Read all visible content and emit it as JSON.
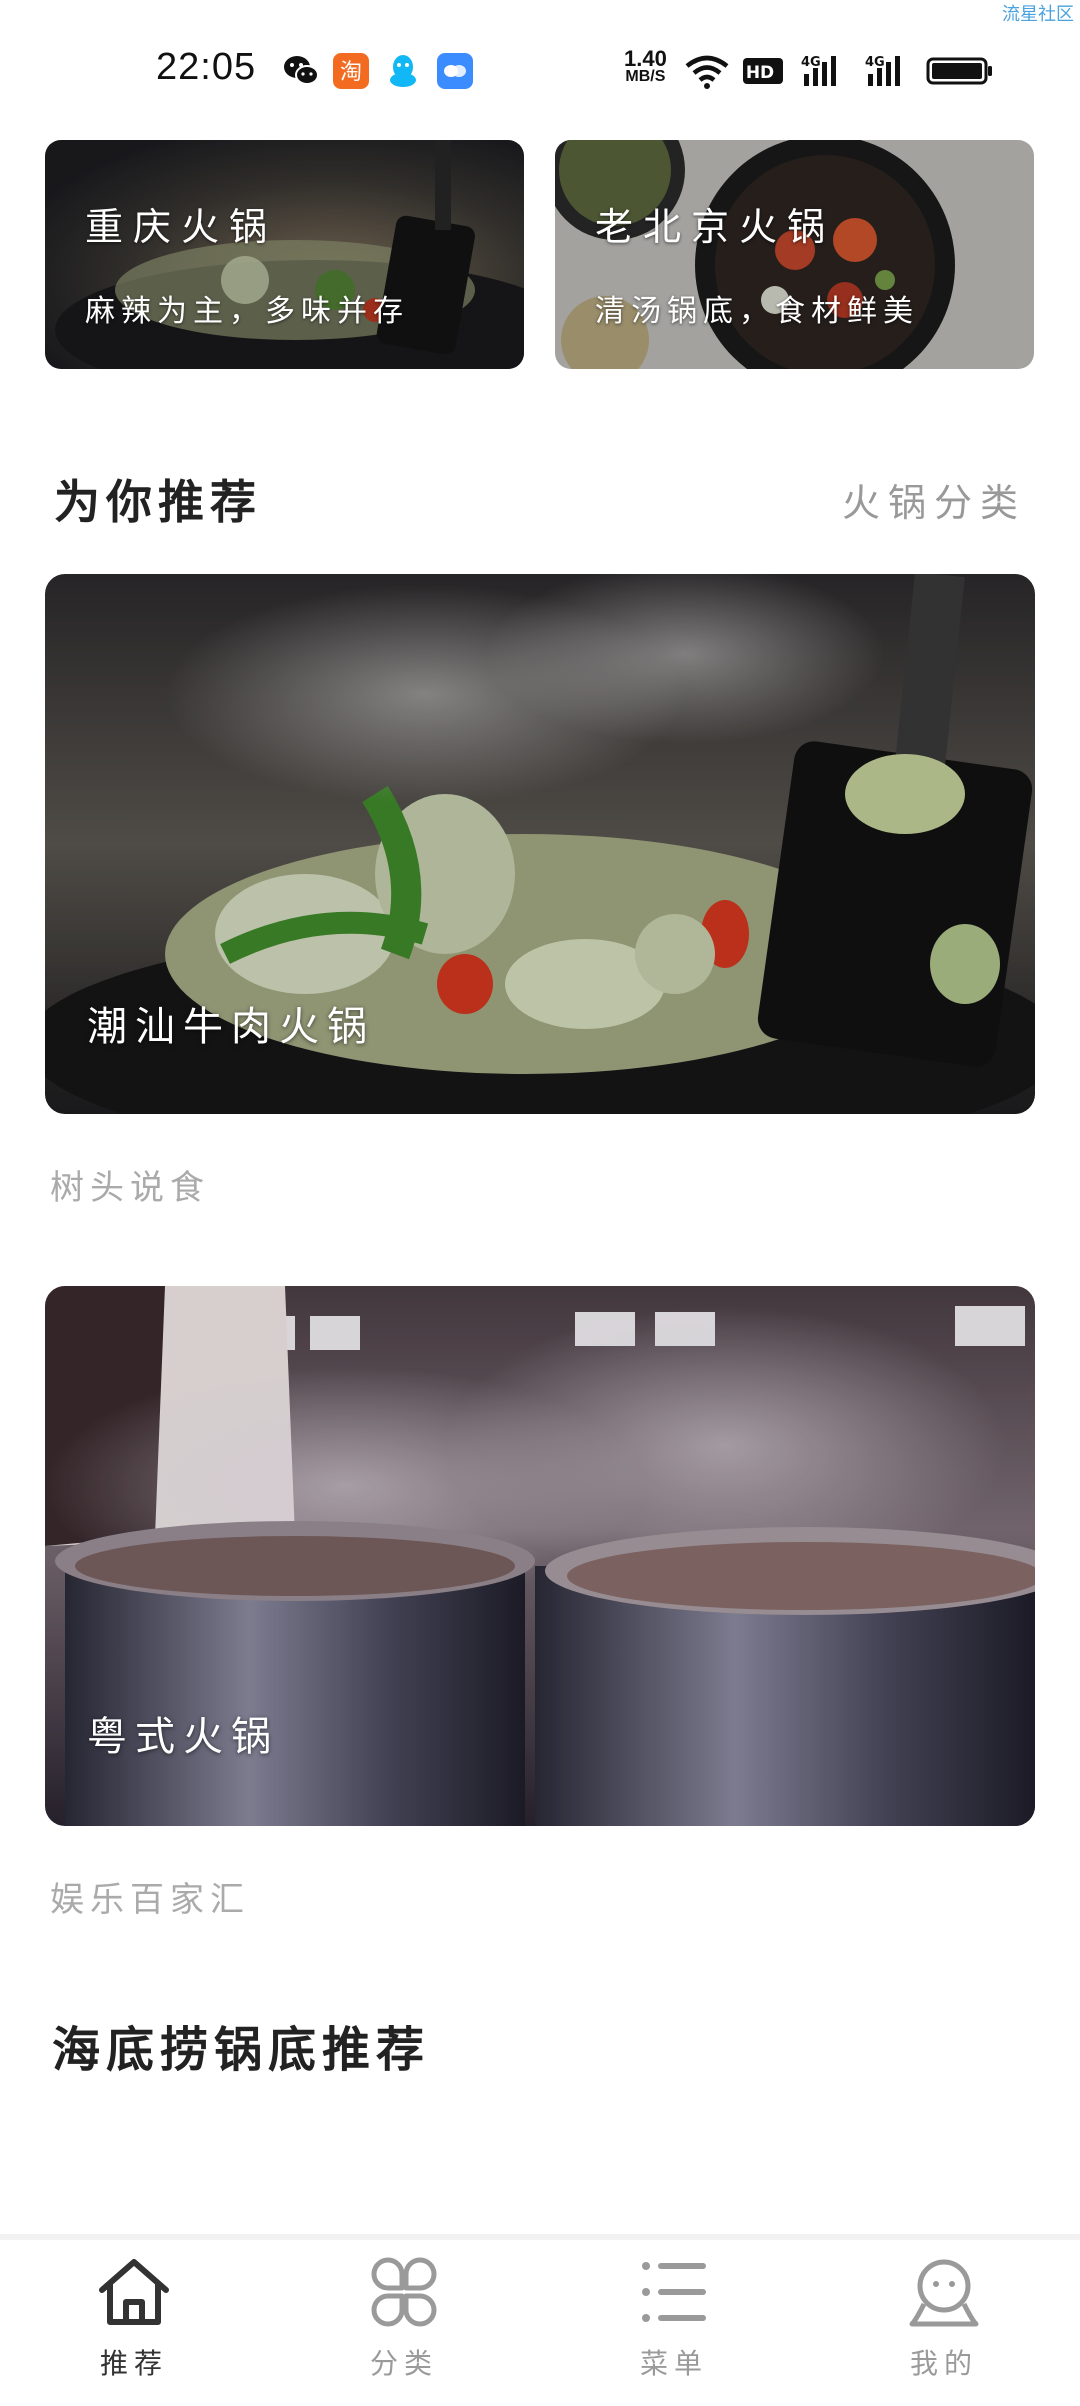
{
  "watermark": "流星社区",
  "status_bar": {
    "time": "22:05",
    "net_speed_value": "1.40",
    "net_speed_unit": "MB/S",
    "hd_label": "HD",
    "signal1_label": "4G",
    "signal2_label": "4G",
    "app_icons": [
      "wechat-icon",
      "taobao-icon",
      "qq-icon",
      "chat-icon"
    ],
    "taobao_char": "淘"
  },
  "top_cards": [
    {
      "title": "重庆火锅",
      "subtitle": "麻辣为主，多味并存"
    },
    {
      "title": "老北京火锅",
      "subtitle": "清汤锅底，食材鲜美"
    }
  ],
  "recommend": {
    "title": "为你推荐",
    "link": "火锅分类",
    "items": [
      {
        "label": "潮汕牛肉火锅",
        "source": "树头说食"
      },
      {
        "label": "粤式火锅",
        "source": "娱乐百家汇"
      }
    ]
  },
  "haidilao": {
    "title": "海底捞锅底推荐"
  },
  "nav": {
    "items": [
      {
        "label": "推荐",
        "icon": "home-icon",
        "active": true
      },
      {
        "label": "分类",
        "icon": "category-icon",
        "active": false
      },
      {
        "label": "菜单",
        "icon": "menu-list-icon",
        "active": false
      },
      {
        "label": "我的",
        "icon": "profile-icon",
        "active": false
      }
    ]
  },
  "colors": {
    "accent_active": "#333333",
    "inactive": "#9a9a9a",
    "taobao": "#f36b21",
    "qq": "#12b7f5",
    "chat": "#3b8cff"
  }
}
